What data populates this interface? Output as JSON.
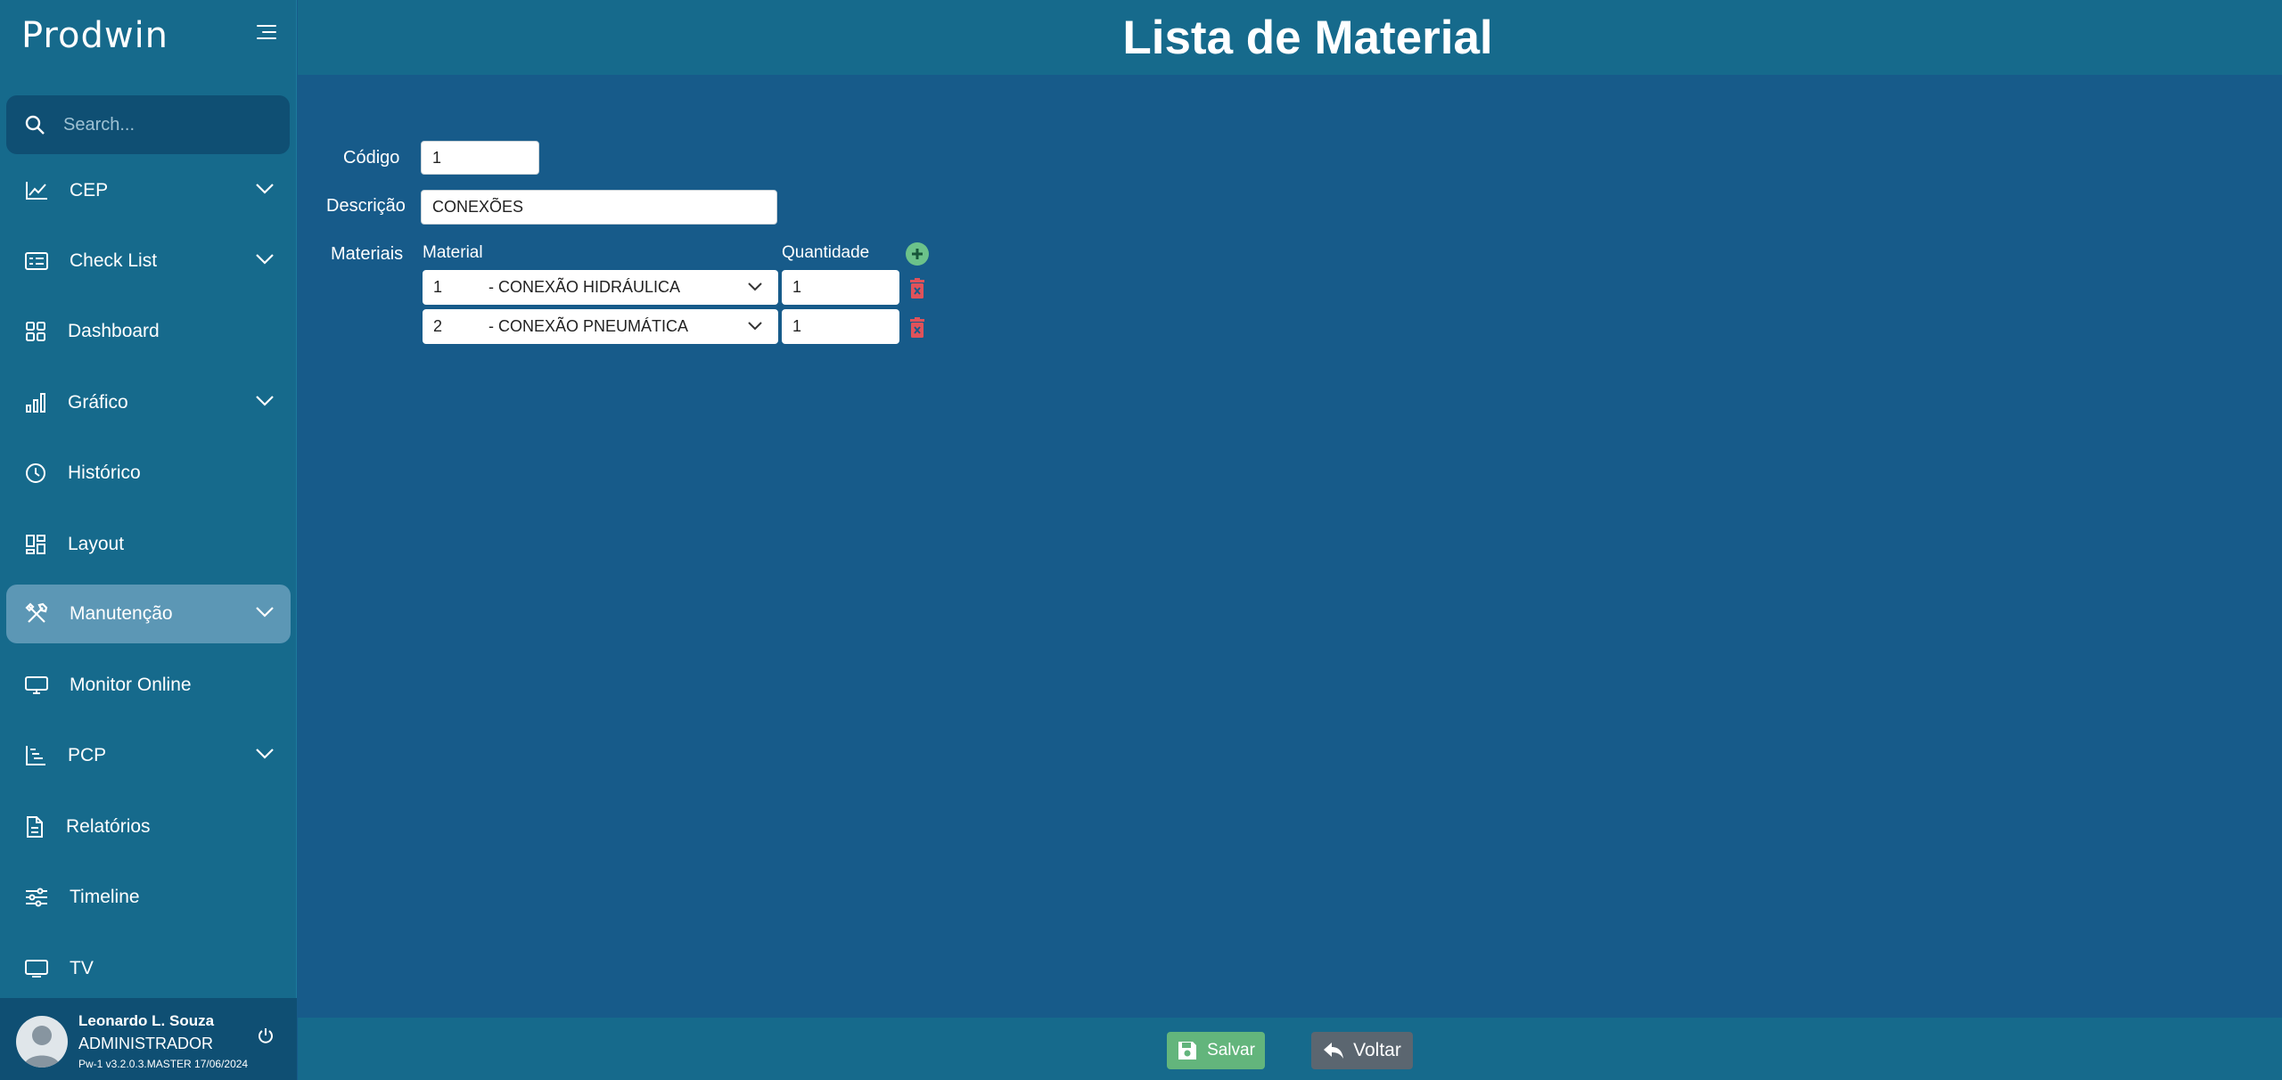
{
  "app": {
    "brand": "Prodwin"
  },
  "search": {
    "placeholder": "Search..."
  },
  "sidebar": {
    "items": [
      {
        "label": "CEP",
        "icon": "line-chart-icon",
        "expandable": true
      },
      {
        "label": "Check List",
        "icon": "list-card-icon",
        "expandable": true
      },
      {
        "label": "Dashboard",
        "icon": "grid-icon",
        "expandable": false
      },
      {
        "label": "Gráfico",
        "icon": "bar-chart-icon",
        "expandable": true
      },
      {
        "label": "Histórico",
        "icon": "clock-icon",
        "expandable": false
      },
      {
        "label": "Layout",
        "icon": "layout-icon",
        "expandable": false
      },
      {
        "label": "Manutenção",
        "icon": "tools-icon",
        "expandable": true,
        "active": true
      },
      {
        "label": "Monitor Online",
        "icon": "monitor-icon",
        "expandable": false
      },
      {
        "label": "PCP",
        "icon": "gantt-icon",
        "expandable": true
      },
      {
        "label": "Relatórios",
        "icon": "document-icon",
        "expandable": false
      },
      {
        "label": "Timeline",
        "icon": "sliders-icon",
        "expandable": false
      },
      {
        "label": "TV",
        "icon": "tv-icon",
        "expandable": false
      }
    ]
  },
  "user": {
    "name": "Leonardo L. Souza",
    "role": "ADMINISTRADOR",
    "version": "Pw-1 v3.2.0.3.MASTER 17/06/2024"
  },
  "page": {
    "title": "Lista de Material"
  },
  "form": {
    "codigo_label": "Código",
    "codigo_value": "1",
    "descricao_label": "Descrição",
    "descricao_value": "CONEXÕES",
    "materiais_label": "Materiais",
    "material_header": "Material",
    "quantidade_header": "Quantidade",
    "rows": [
      {
        "code": "1",
        "name": "- CONEXÃO HIDRÁULICA",
        "quantity": "1"
      },
      {
        "code": "2",
        "name": "- CONEXÃO PNEUMÁTICA",
        "quantity": "1"
      }
    ]
  },
  "footer": {
    "save_label": "Salvar",
    "back_label": "Voltar"
  },
  "colors": {
    "sidebar_bg": "#166a8c",
    "main_bg": "#175b8a",
    "active_item": "#5c97b5",
    "save_green": "#63b57c",
    "add_green": "#6cc28a",
    "delete_red": "#e0525a"
  }
}
